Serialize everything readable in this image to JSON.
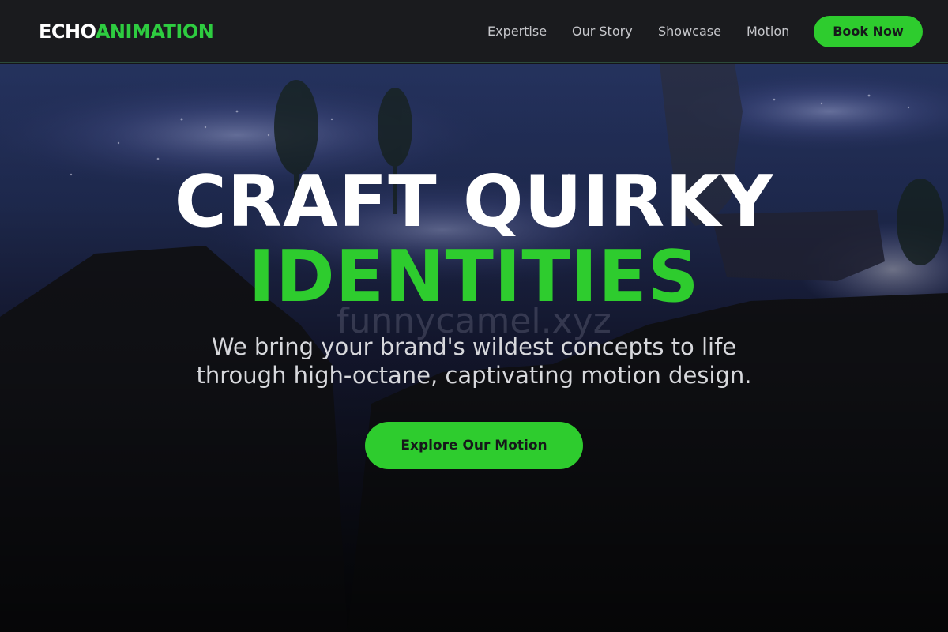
{
  "brand": {
    "part1": "ECHO",
    "part2": "ANIMATION"
  },
  "nav": {
    "items": [
      {
        "label": "Expertise"
      },
      {
        "label": "Our Story"
      },
      {
        "label": "Showcase"
      },
      {
        "label": "Motion"
      }
    ],
    "book_label": "Book Now"
  },
  "hero": {
    "headline_line1": "CRAFT QUIRKY",
    "headline_line2": "IDENTITIES",
    "watermark": "funnycamel.xyz",
    "subtitle_line1": "We bring your brand's wildest concepts to life",
    "subtitle_line2": "through high-octane, captivating motion design.",
    "cta_label": "Explore Our Motion"
  },
  "colors": {
    "accent": "#2ecc2e",
    "header_bg": "#1a1b1e",
    "page_bg": "#141518",
    "text_light": "#d7d8dc"
  }
}
